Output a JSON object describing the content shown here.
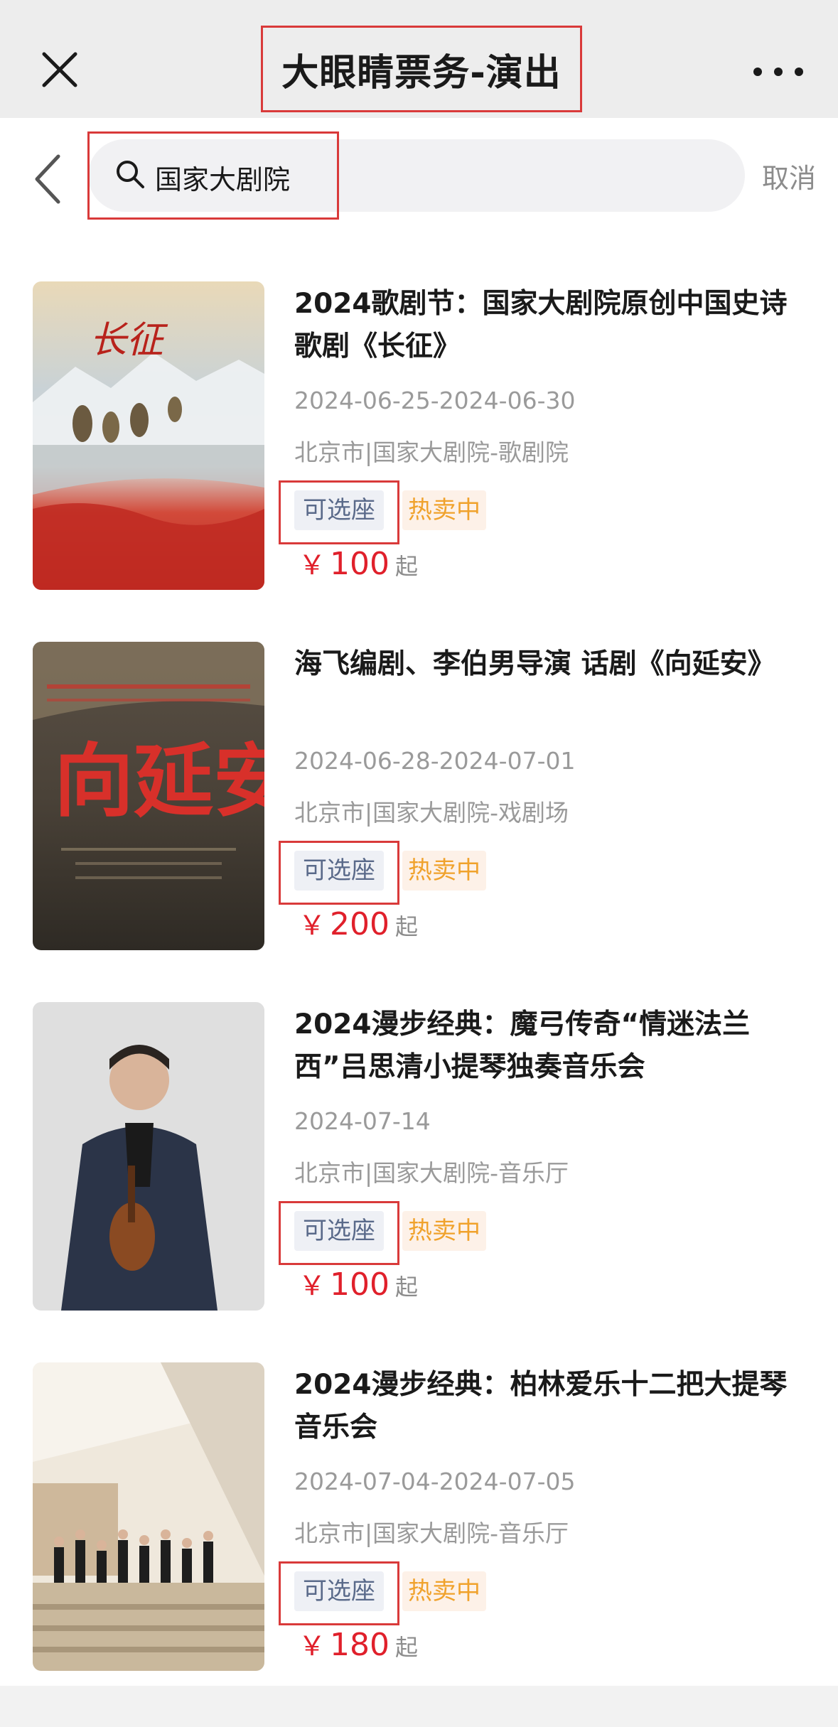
{
  "header": {
    "title": "大眼睛票务-演出",
    "close_icon": "close-icon",
    "more_icon": "more-horizontal-icon"
  },
  "search": {
    "value": "国家大剧院",
    "placeholder": "",
    "cancel_label": "取消",
    "back_icon": "chevron-left-icon",
    "search_icon": "search-icon"
  },
  "results": [
    {
      "title": "2024歌剧节：国家大剧院原创中国史诗歌剧《长征》",
      "date": "2024-06-25-2024-06-30",
      "venue": "北京市|国家大剧院-歌剧院",
      "tag_seat": "可选座",
      "tag_hot": "热卖中",
      "currency": "￥",
      "price": "100",
      "price_suffix": "起",
      "poster_text": "长征"
    },
    {
      "title": "海飞编剧、李伯男导演 话剧《向延安》",
      "date": "2024-06-28-2024-07-01",
      "venue": "北京市|国家大剧院-戏剧场",
      "tag_seat": "可选座",
      "tag_hot": "热卖中",
      "currency": "￥",
      "price": "200",
      "price_suffix": "起",
      "poster_text": "向延安"
    },
    {
      "title": "2024漫步经典：魔弓传奇“情迷法兰西”吕思清小提琴独奏音乐会",
      "date": "2024-07-14",
      "venue": "北京市|国家大剧院-音乐厅",
      "tag_seat": "可选座",
      "tag_hot": "热卖中",
      "currency": "￥",
      "price": "100",
      "price_suffix": "起",
      "poster_text": ""
    },
    {
      "title": "2024漫步经典：柏林爱乐十二把大提琴音乐会",
      "date": "2024-07-04-2024-07-05",
      "venue": "北京市|国家大剧院-音乐厅",
      "tag_seat": "可选座",
      "tag_hot": "热卖中",
      "currency": "￥",
      "price": "180",
      "price_suffix": "起",
      "poster_text": ""
    }
  ],
  "colors": {
    "accent_price": "#e0202b",
    "tag_hot": "#f0a22c",
    "tag_seat": "#5a6a8a",
    "highlight_box": "#d93a3a"
  }
}
